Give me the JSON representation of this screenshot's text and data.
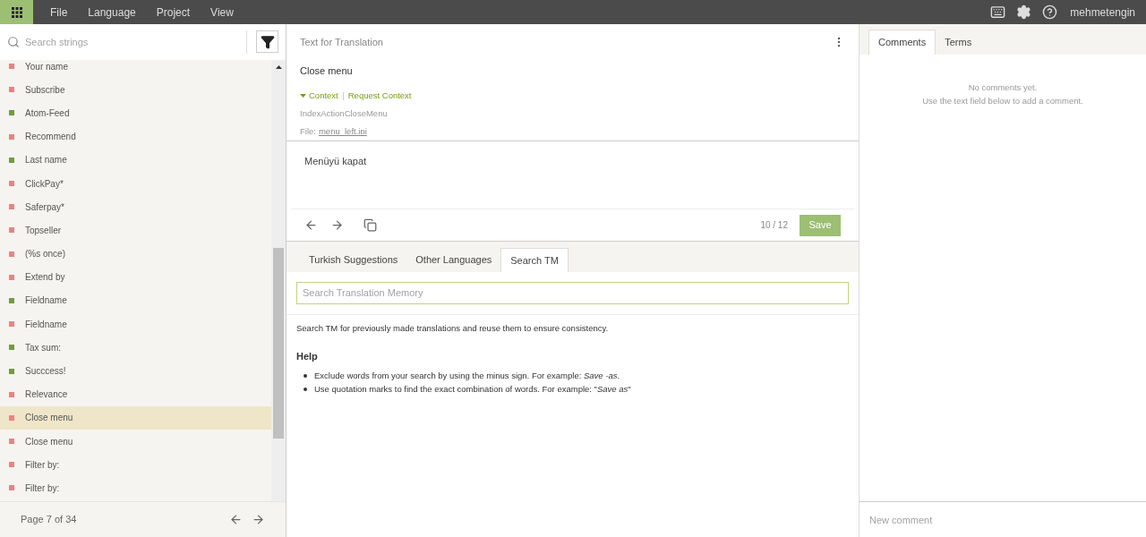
{
  "menu": [
    "File",
    "Language",
    "Project",
    "View"
  ],
  "user": "mehmetengin",
  "search": {
    "placeholder": "Search strings"
  },
  "strings": [
    {
      "text": "Your name",
      "translated": false,
      "selected": false
    },
    {
      "text": "Subscribe",
      "translated": false,
      "selected": false
    },
    {
      "text": "Atom-Feed",
      "translated": true,
      "selected": false
    },
    {
      "text": "Recommend",
      "translated": false,
      "selected": false
    },
    {
      "text": "Last name",
      "translated": true,
      "selected": false
    },
    {
      "text": "ClickPay*",
      "translated": false,
      "selected": false
    },
    {
      "text": "Saferpay*",
      "translated": false,
      "selected": false
    },
    {
      "text": "Topseller",
      "translated": false,
      "selected": false
    },
    {
      "text": "(%s once)",
      "translated": false,
      "selected": false
    },
    {
      "text": "Extend by",
      "translated": false,
      "selected": false
    },
    {
      "text": "Fieldname",
      "translated": true,
      "selected": false
    },
    {
      "text": "Fieldname",
      "translated": false,
      "selected": false
    },
    {
      "text": "Tax sum:",
      "translated": true,
      "selected": false
    },
    {
      "text": "Succcess!",
      "translated": true,
      "selected": false
    },
    {
      "text": "Relevance",
      "translated": false,
      "selected": false
    },
    {
      "text": "Close menu",
      "translated": false,
      "selected": true
    },
    {
      "text": "Close menu",
      "translated": false,
      "selected": false
    },
    {
      "text": "Filter by:",
      "translated": false,
      "selected": false
    },
    {
      "text": "Filter by:",
      "translated": false,
      "selected": false
    }
  ],
  "pager": "Page 7 of 34",
  "source": {
    "heading": "Text for Translation",
    "text": "Close menu",
    "context_toggle": "Context",
    "request_context": "Request Context",
    "key": "IndexActionCloseMenu",
    "file_label": "File:",
    "file": "menu_left.ini"
  },
  "translation": {
    "text": "Menüyü kapat",
    "count": "10 / 12",
    "save": "Save"
  },
  "tabs": [
    {
      "label": "Turkish Suggestions",
      "selected": false
    },
    {
      "label": "Other Languages",
      "selected": false
    },
    {
      "label": "Search TM",
      "selected": true
    }
  ],
  "tm": {
    "placeholder": "Search Translation Memory",
    "intro": "Search TM for previously made translations and reuse them to ensure consistency.",
    "help_title": "Help",
    "help": [
      "Exclude words from your search by using the minus sign. For example: *Save -as*.",
      "Use quotation marks to find the exact combination of words. For example: \"*Save as*\""
    ]
  },
  "side_tabs": [
    {
      "label": "Comments",
      "selected": true
    },
    {
      "label": "Terms",
      "selected": false
    }
  ],
  "comments": {
    "empty": "No comments yet.",
    "hint": "Use the text field below to add a comment.",
    "placeholder": "New comment"
  }
}
